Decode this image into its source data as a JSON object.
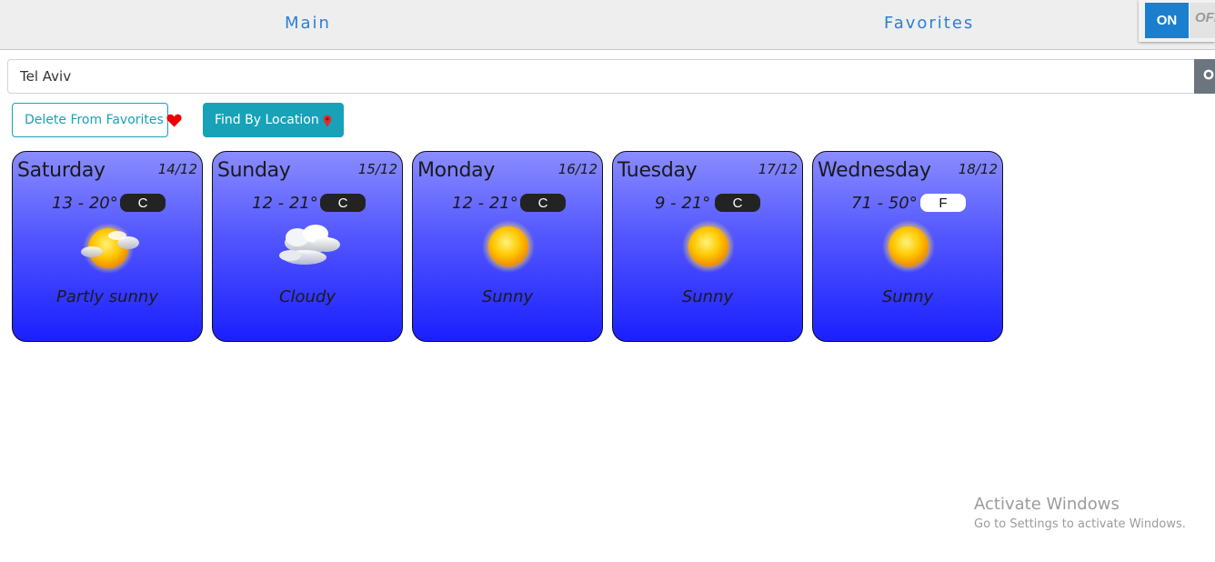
{
  "nav": {
    "main_label": "Main",
    "favorites_label": "Favorites"
  },
  "toggle": {
    "on_label": "ON",
    "off_label": "OFF",
    "accent": "#1a7fcf"
  },
  "search": {
    "value": "Tel Aviv",
    "icon": "search-icon"
  },
  "buttons": {
    "delete_favorites_label": "Delete From Favorites",
    "delete_icon": "heart-icon",
    "find_location_label": "Find By Location",
    "location_icon": "map-pin-icon"
  },
  "forecast": [
    {
      "day": "Saturday",
      "date": "14/12",
      "temp": "13 - 20°",
      "unit": "C",
      "icon": "partly-sunny-icon",
      "desc": "Partly sunny"
    },
    {
      "day": "Sunday",
      "date": "15/12",
      "temp": "12 - 21°",
      "unit": "C",
      "icon": "cloudy-icon",
      "desc": "Cloudy"
    },
    {
      "day": "Monday",
      "date": "16/12",
      "temp": "12 - 21°",
      "unit": "C",
      "icon": "sunny-icon",
      "desc": "Sunny"
    },
    {
      "day": "Tuesday",
      "date": "17/12",
      "temp": "9 - 21°",
      "unit": "C",
      "icon": "sunny-icon",
      "desc": "Sunny"
    },
    {
      "day": "Wednesday",
      "date": "18/12",
      "temp": "71 - 50°",
      "unit": "F",
      "icon": "sunny-icon",
      "desc": "Sunny"
    }
  ],
  "watermark": {
    "title": "Activate Windows",
    "subtitle": "Go to Settings to activate Windows."
  },
  "colors": {
    "card_top": "#8a8cff",
    "card_bottom": "#1a1fff",
    "button": "#17a2b8",
    "nav_link": "#2b7fd6"
  }
}
